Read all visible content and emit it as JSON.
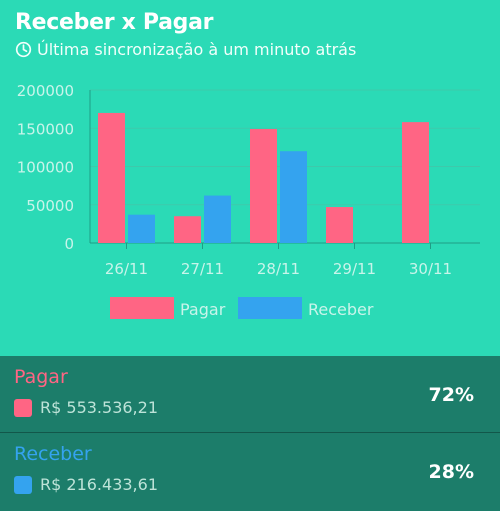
{
  "header": {
    "title": "Receber x Pagar",
    "sync_text": "Última sincronização à um minuto atrás",
    "sync_icon": "clock-icon"
  },
  "colors": {
    "background": "#2bdab6",
    "panel": "#1c7d6a",
    "pagar": "#ff6584",
    "receber": "#34a3ef"
  },
  "chart_data": {
    "type": "bar",
    "categories": [
      "26/11",
      "27/11",
      "28/11",
      "29/11",
      "30/11"
    ],
    "series": [
      {
        "name": "Pagar",
        "values": [
          170000,
          35000,
          149000,
          47000,
          158000
        ]
      },
      {
        "name": "Receber",
        "values": [
          37000,
          62000,
          120000,
          0,
          0
        ]
      }
    ],
    "yticks": [
      "0",
      "50000",
      "100000",
      "150000",
      "200000"
    ],
    "ylim": [
      0,
      200000
    ],
    "grid": true,
    "legend": "bottom-center"
  },
  "summary": {
    "pagar": {
      "label": "Pagar",
      "amount": "R$ 553.536,21",
      "percent": "72%"
    },
    "receber": {
      "label": "Receber",
      "amount": "R$ 216.433,61",
      "percent": "28%"
    }
  }
}
